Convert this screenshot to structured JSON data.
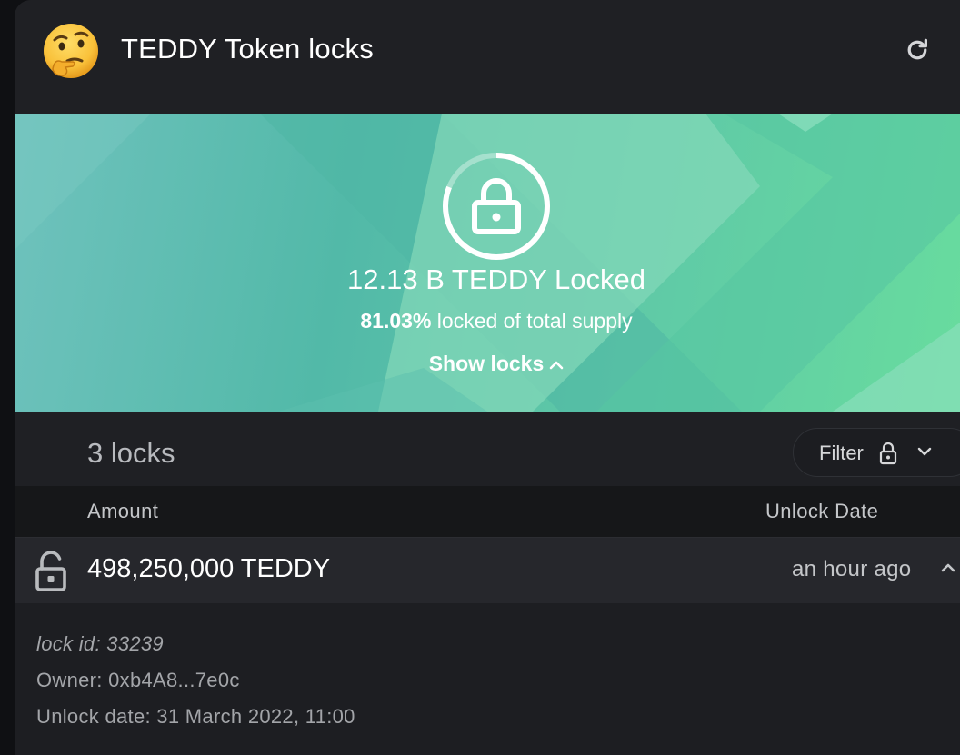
{
  "header": {
    "title": "TEDDY Token locks",
    "emoji_icon": "thinking-face-emoji",
    "refresh_icon": "refresh-icon"
  },
  "banner": {
    "locked_amount": "12.13 B TEDDY Locked",
    "locked_percent": "81.03%",
    "locked_percent_suffix": " locked of total supply",
    "locked_fraction": 0.8103,
    "show_locks_label": "Show locks",
    "gradient_colors": [
      "#6fc2bd",
      "#52b9a8",
      "#68dc9e"
    ]
  },
  "locks_bar": {
    "count_label": "3 locks",
    "filter_label": "Filter"
  },
  "table": {
    "headers": {
      "amount": "Amount",
      "unlock_date": "Unlock Date"
    },
    "rows": [
      {
        "amount": "498,250,000 TEDDY",
        "unlock_relative": "an hour ago",
        "expanded": true,
        "details": {
          "lock_id": "lock id: 33239",
          "owner": "Owner: 0xb4A8...7e0c",
          "unlock_date": "Unlock date: 31 March 2022, 11:00"
        }
      }
    ]
  }
}
